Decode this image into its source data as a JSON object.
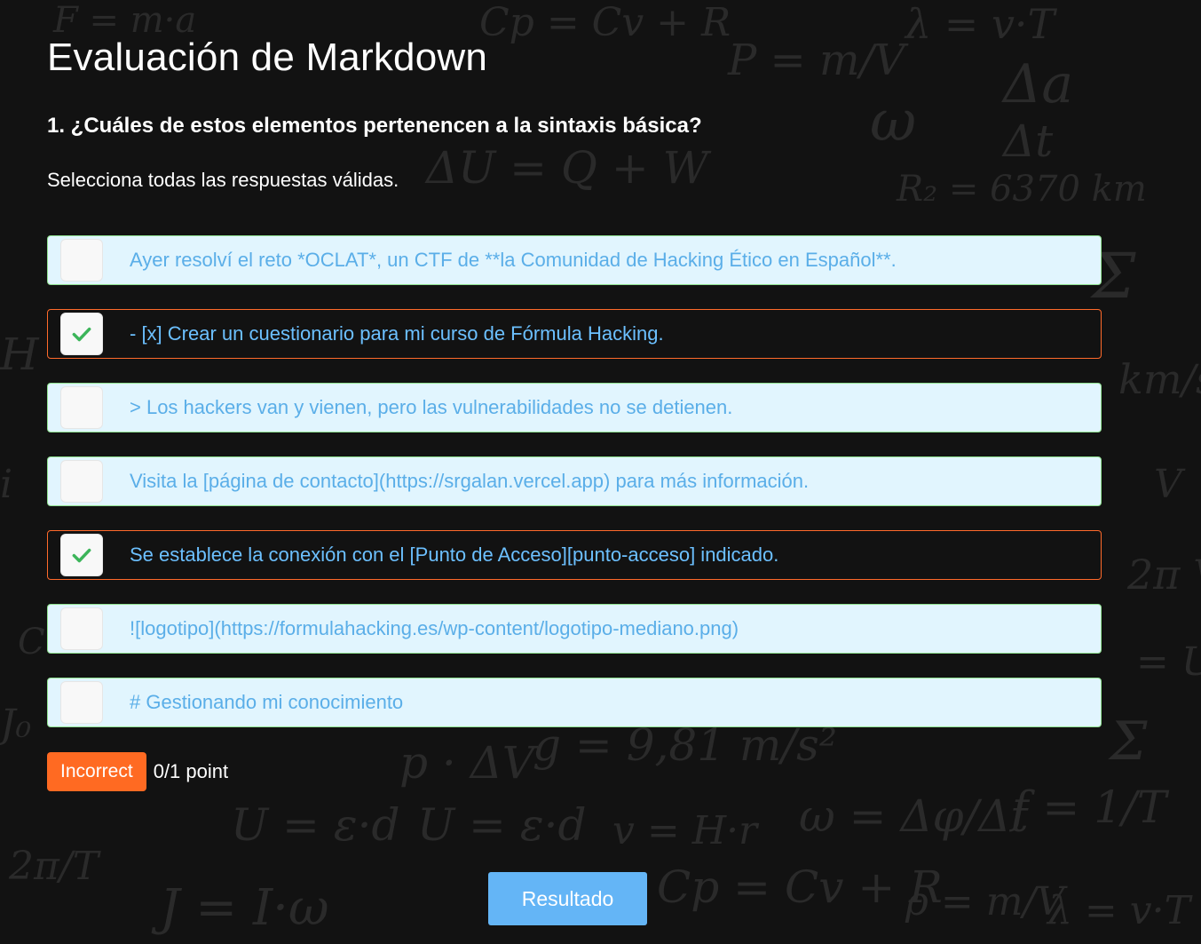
{
  "page": {
    "title": "Evaluación de Markdown",
    "question": "1. ¿Cuáles de estos elementos pertenencen a la sintaxis básica?",
    "hint": "Selecciona todas las respuestas válidas."
  },
  "options": [
    {
      "label": "Ayer resolví el reto *OCLAT*, un CTF de **la Comunidad de Hacking Ético en Español**.",
      "checked": false
    },
    {
      "label": "- [x] Crear un cuestionario para mi curso de Fórmula Hacking.",
      "checked": true
    },
    {
      "label": "> Los hackers van y vienen, pero las vulnerabilidades no se detienen.",
      "checked": false
    },
    {
      "label": "Visita la [página de contacto](https://srgalan.vercel.app) para más información.",
      "checked": false
    },
    {
      "label": "Se establece la conexión con el [Punto de Acceso][punto-acceso] indicado.",
      "checked": true
    },
    {
      "label": "![logotipo](https://formulahacking.es/wp-content/logotipo-mediano.png)",
      "checked": false
    },
    {
      "label": "# Gestionando mi conocimiento",
      "checked": false
    }
  ],
  "feedback": {
    "status": "Incorrect",
    "score": "0/1 point"
  },
  "actions": {
    "result_label": "Resultado"
  },
  "colors": {
    "background": "#121212",
    "option_bg": "#e1f5fe",
    "option_border": "#8fe08f",
    "checked_border": "#ff6a2b",
    "option_text": "#5aaee8",
    "check_mark": "#3cb55a",
    "incorrect_badge": "#ff6a22",
    "result_button": "#64b5f6"
  }
}
